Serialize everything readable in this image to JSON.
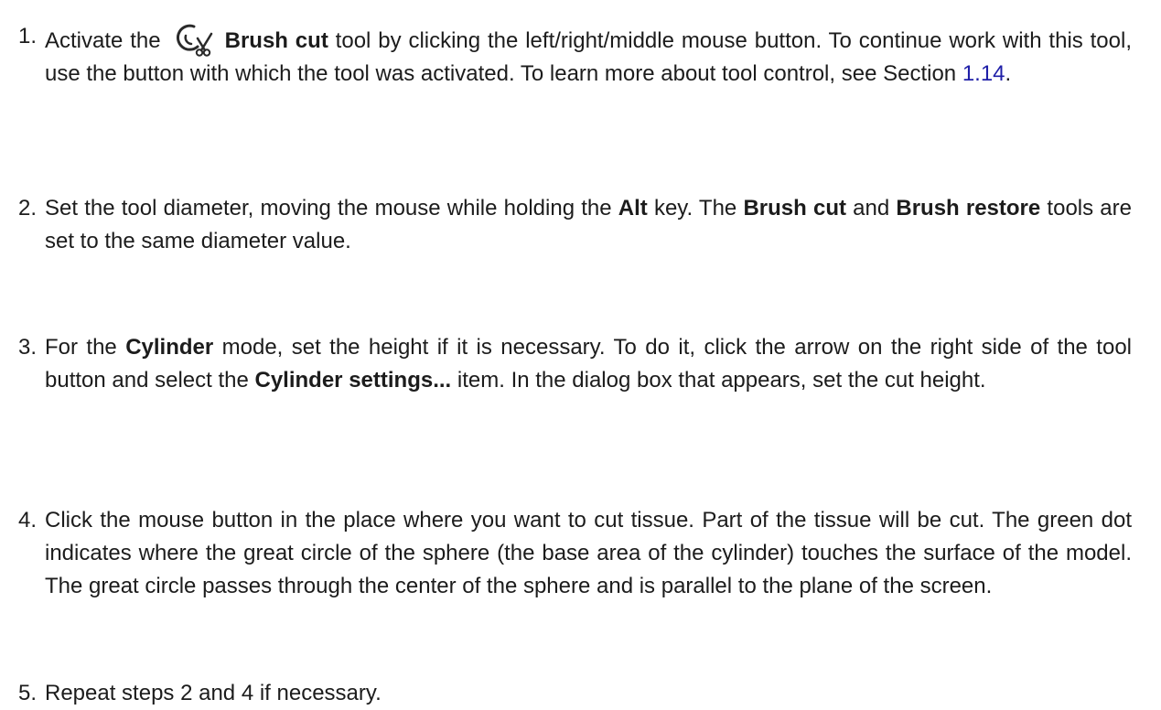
{
  "steps": [
    {
      "number": "1.",
      "pre_icon": "Activate the",
      "icon": "brush-cut-icon",
      "bold_tool": "Brush cut",
      "text_a": " tool by clicking the left/right/middle mouse button.  To continue work with this tool, use the button with which the tool was activated. To learn more about tool control, see Section ",
      "link": "1.14",
      "text_b": "."
    },
    {
      "number": "2.",
      "text_a": "Set the tool diameter, moving the mouse while holding the ",
      "bold_a": "Alt",
      "text_b": " key.  The ",
      "bold_b": "Brush cut",
      "text_c": " and ",
      "bold_c": "Brush restore",
      "text_d": " tools are set to the same diameter value."
    },
    {
      "number": "3.",
      "text_a": "For the ",
      "bold_a": "Cylinder",
      "text_b": " mode, set the height if it is necessary. To do it, click the arrow on the right side of the tool button and select the ",
      "bold_b": "Cylinder settings...",
      "text_c": "  item.  In the dialog box that appears, set the cut height."
    },
    {
      "number": "4.",
      "text": "Click the mouse button in the place where you want to cut tissue.  Part of the tissue will be cut. The green dot indicates where the great circle of the sphere (the base area of the cylinder) touches the surface of the model.  The great circle passes through the center of the sphere and is parallel to the plane of the screen."
    },
    {
      "number": "5.",
      "text": "Repeat steps 2 and 4 if necessary."
    }
  ],
  "colors": {
    "text": "#1c1c1c",
    "link": "#1f1fa8"
  }
}
